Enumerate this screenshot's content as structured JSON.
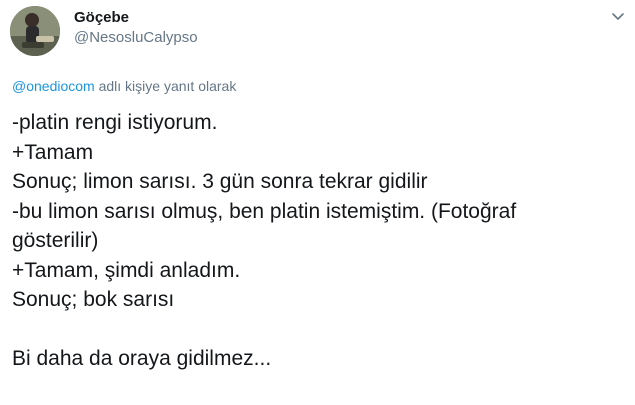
{
  "tweet": {
    "author": {
      "display_name": "Göçebe",
      "handle": "@NesosluCalypso",
      "avatar_icon": "profile-avatar"
    },
    "reply_context": {
      "mention": "@onediocom",
      "suffix": "adlı kişiye yanıt olarak"
    },
    "menu_icon": "chevron-down-icon",
    "lines": [
      "-platin rengi istiyorum.",
      "+Tamam",
      "Sonuç; limon sarısı. 3 gün sonra tekrar gidilir",
      "-bu limon sarısı olmuş, ben platin istemiştim. (Fotoğraf",
      "gösterilir)",
      "+Tamam, şimdi anladım.",
      "Sonuç; bok sarısı",
      "",
      "Bi daha da oraya gidilmez..."
    ]
  },
  "colors": {
    "text": "#14171a",
    "secondary": "#657786",
    "link": "#1b95e0"
  }
}
